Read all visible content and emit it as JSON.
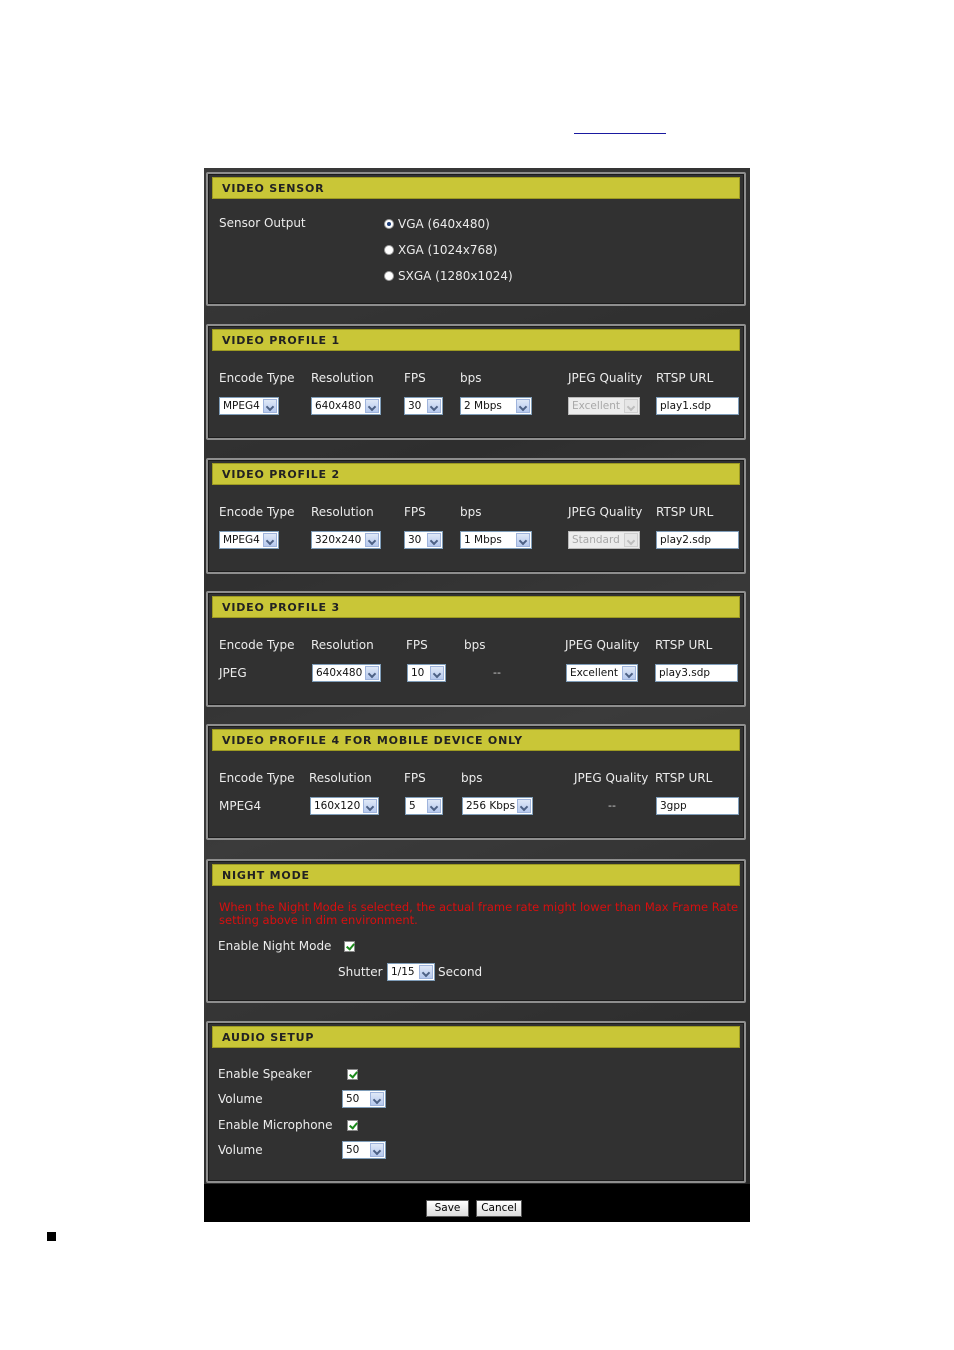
{
  "video_sensor": {
    "title": "VIDEO SENSOR",
    "sensor_output_label": "Sensor Output",
    "options": [
      "VGA (640x480)",
      "XGA (1024x768)",
      "SXGA (1280x1024)"
    ],
    "selected_index": 0
  },
  "columns": {
    "encode_type": "Encode Type",
    "resolution": "Resolution",
    "fps": "FPS",
    "bps": "bps",
    "jpeg_quality": "JPEG Quality",
    "rtsp_url": "RTSP URL"
  },
  "profiles": [
    {
      "title": "VIDEO PROFILE 1",
      "encode": "MPEG4",
      "resolution": "640x480",
      "fps": "30",
      "bps": "2 Mbps",
      "jpeg_quality": "Excellent",
      "rtsp_url": "play1.sdp"
    },
    {
      "title": "VIDEO PROFILE 2",
      "encode": "MPEG4",
      "resolution": "320x240",
      "fps": "30",
      "bps": "1 Mbps",
      "jpeg_quality": "Standard",
      "rtsp_url": "play2.sdp"
    },
    {
      "title": "VIDEO PROFILE 3",
      "encode": "JPEG",
      "resolution": "640x480",
      "fps": "10",
      "bps": "--",
      "jpeg_quality": "Excellent",
      "rtsp_url": "play3.sdp"
    },
    {
      "title": "VIDEO PROFILE 4 FOR MOBILE DEVICE ONLY",
      "encode": "MPEG4",
      "resolution": "160x120",
      "fps": "5",
      "bps": "256 Kbps",
      "jpeg_quality": "--",
      "rtsp_url": "3gpp"
    }
  ],
  "night_mode": {
    "title": "NIGHT MODE",
    "warning_line1": "When the Night Mode is selected, the actual frame rate might lower than Max Frame Rate",
    "warning_line2": "setting above in dim environment.",
    "enable_label": "Enable Night Mode",
    "enabled": true,
    "shutter_label": "Shutter",
    "shutter_value": "1/15",
    "second_label": "Second"
  },
  "audio_setup": {
    "title": "AUDIO SETUP",
    "speaker_label": "Enable Speaker",
    "speaker_enabled": true,
    "speaker_volume_label": "Volume",
    "speaker_volume": "50",
    "microphone_label": "Enable Microphone",
    "microphone_enabled": true,
    "microphone_volume_label": "Volume",
    "microphone_volume": "50"
  },
  "buttons": {
    "save": "Save",
    "cancel": "Cancel"
  },
  "colors": {
    "header": "#c9c637",
    "panel": "#313131",
    "warning": "#d80f0f"
  }
}
